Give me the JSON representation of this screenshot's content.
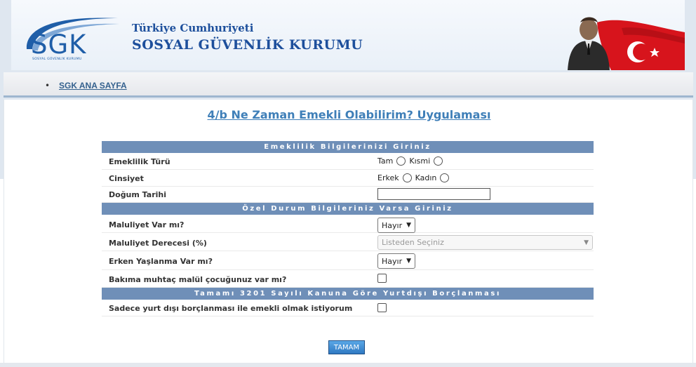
{
  "header": {
    "logo_text": "SGK",
    "logo_subtitle": "SOSYAL GÜVENLİK KURUMU",
    "title_line1": "Türkiye Cumhuriyeti",
    "title_line2": "SOSYAL GÜVENLİK KURUMU"
  },
  "nav": {
    "home_link": "SGK ANA SAYFA"
  },
  "page": {
    "title": "4/b Ne Zaman Emekli Olabilirim? Uygulaması"
  },
  "sections": {
    "retirement_info": "Emeklilik Bilgilerinizi Giriniz",
    "special_status": "Özel Durum Bilgileriniz Varsa Giriniz",
    "abroad_debt": "Tamamı 3201 Sayılı Kanuna Göre Yurtdışı Borçlanması"
  },
  "fields": {
    "retirement_type": {
      "label": "Emeklilik Türü",
      "options": [
        "Tam",
        "Kısmi"
      ]
    },
    "gender": {
      "label": "Cinsiyet",
      "options": [
        "Erkek",
        "Kadın"
      ]
    },
    "birth_date": {
      "label": "Doğum Tarihi",
      "value": ""
    },
    "disability": {
      "label": "Maluliyet Var mı?",
      "selected": "Hayır"
    },
    "disability_degree": {
      "label": "Maluliyet Derecesi (%)",
      "selected": "Listeden Seçiniz"
    },
    "early_aging": {
      "label": "Erken Yaşlanma Var mı?",
      "selected": "Hayır"
    },
    "disabled_child": {
      "label": "Bakıma muhtaç malül çocuğunuz var mı?",
      "checked": false
    },
    "abroad_only": {
      "label": "Sadece yurt dışı borçlanması ile emekli olmak istiyorum",
      "checked": false
    }
  },
  "buttons": {
    "submit": "TAMAM"
  },
  "colors": {
    "section_header": "#6f8fb8",
    "title_link": "#3f7fb8",
    "brand": "#1d4f9c"
  }
}
